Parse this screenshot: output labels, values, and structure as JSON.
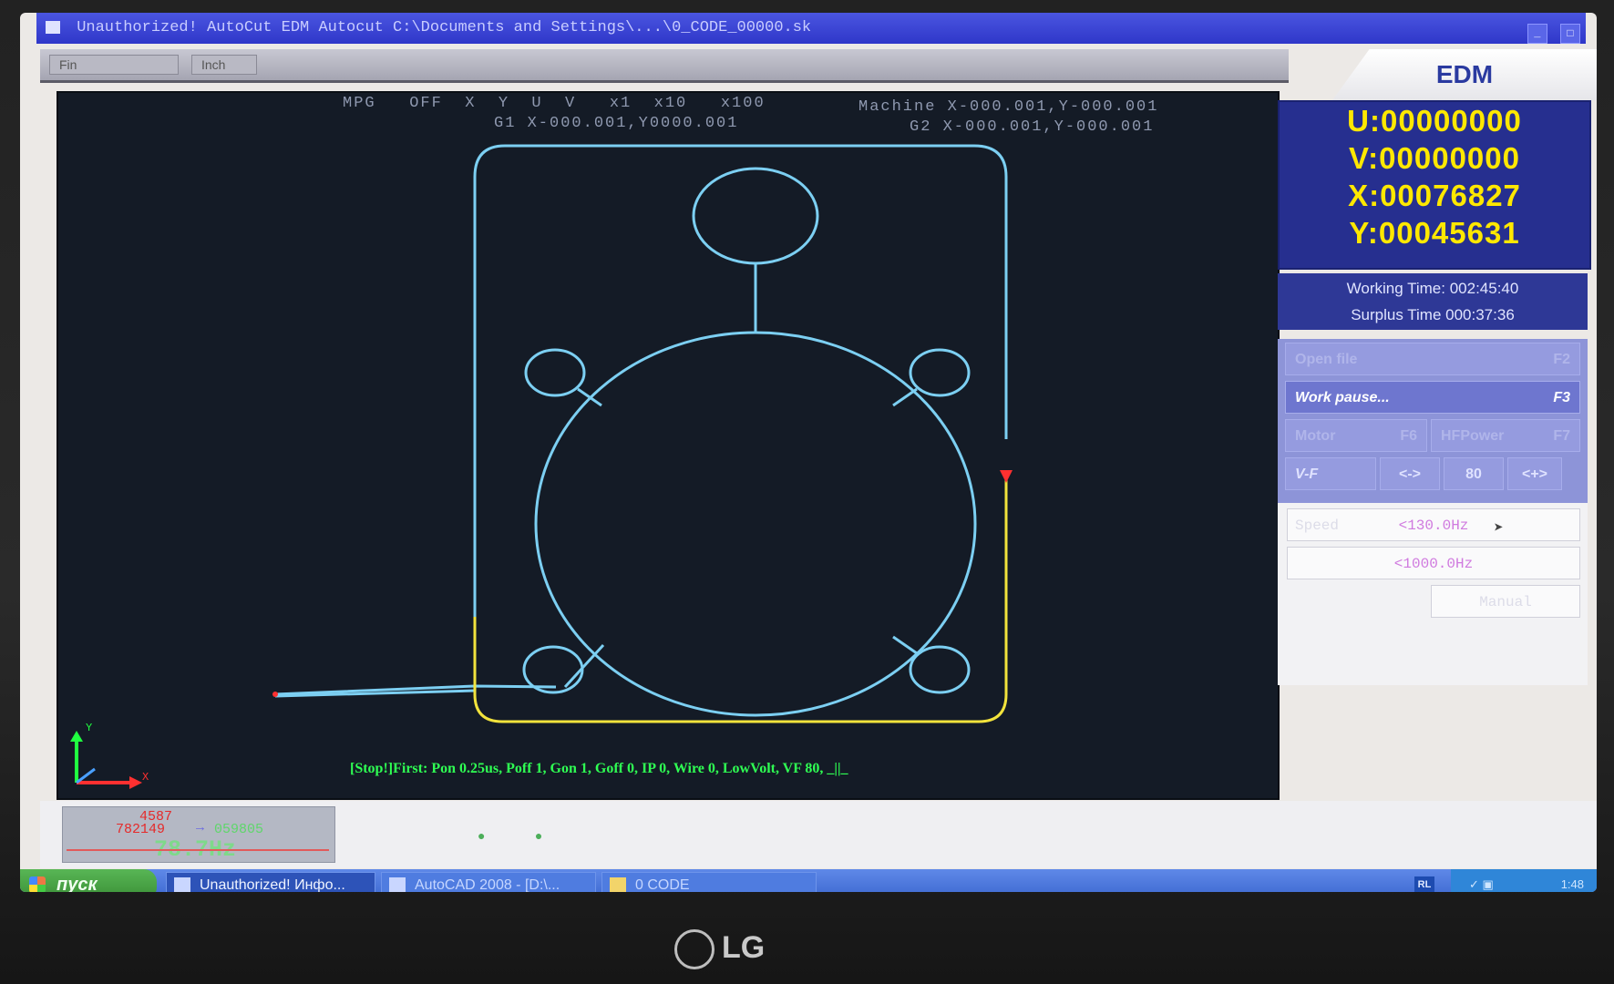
{
  "window": {
    "title": "Unauthorized! AutoCut EDM    Autocut   C:\\Documents and Settings\\...\\0_CODE_00000.sk",
    "controls": [
      "_",
      "□"
    ]
  },
  "menubar": {
    "items": [
      "Fin",
      "Inch"
    ]
  },
  "edm_tab": {
    "label": "EDM"
  },
  "canvas": {
    "hud_mpg": "MPG   OFF  X  Y  U  V   x1  x10   x100",
    "hud_g1": "G1 X-000.001,Y0000.001",
    "hud_machine": "Machine X-000.001,Y-000.001",
    "hud_g2": "G2 X-000.001,Y-000.001",
    "axis_x": "X",
    "axis_y": "Y",
    "status": "[Stop!]First: Pon 0.25us, Poff 1, Gon 1, Goff 0, IP 0, Wire 0, LowVolt, VF 80, _||_",
    "colors": {
      "path": "#7ccff2",
      "done_path": "#f2e33c",
      "marker": "#ff3030",
      "status_text": "#2fff53"
    }
  },
  "coords": {
    "u": "U:00000000",
    "v": "V:00000000",
    "x": "X:00076827",
    "y": "Y:00045631"
  },
  "times": {
    "working": "Working Time: 002:45:40",
    "surplus": "Surplus Time 000:37:36"
  },
  "buttons": {
    "open_file": {
      "label": "Open file",
      "key": "F2"
    },
    "work_pause": {
      "label": "Work pause...",
      "key": "F3"
    },
    "motor": {
      "label": "Motor",
      "key": "F6"
    },
    "hf_power": {
      "label": "HFPower",
      "key": "F7"
    },
    "vf_label": "V-F",
    "vf_left": "<->",
    "vf_value": "80",
    "vf_right": "<+>",
    "speed_label": "Speed",
    "speed_value": "<130.0Hz",
    "freq2_value": "<1000.0Hz",
    "manual": "Manual"
  },
  "mini_gauge": {
    "line1": "4587",
    "line2": "782149",
    "line3": "059805",
    "freq": "78.7Hz"
  },
  "taskbar": {
    "start": "пуск",
    "tasks": [
      "Unauthorized! Инфо...",
      "AutoCAD 2008 - [D:\\...",
      "0 CODE"
    ],
    "lang": "RL",
    "clock": "1:48"
  },
  "monitor": {
    "brand": "LG"
  }
}
